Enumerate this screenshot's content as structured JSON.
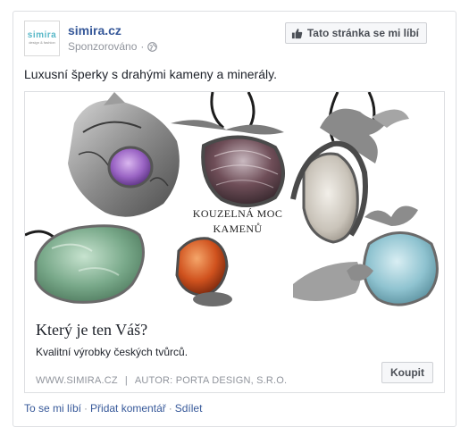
{
  "post": {
    "page_name": "simira.cz",
    "logo": {
      "wordmark": "simira",
      "sub": "design & fashion"
    },
    "sponsored_label": "Sponzorováno",
    "sponsored_separator": "·",
    "like_page_label": "Tato stránka se mi líbí",
    "text": "Luxusní šperky s drahými kameny a minerály."
  },
  "attachment": {
    "image_tagline_line1": "KOUZELNÁ MOC",
    "image_tagline_line2": "KAMENŮ",
    "title": "Který je ten Váš?",
    "description": "Kvalitní výrobky českých tvůrců.",
    "caption_domain": "WWW.SIMIRA.CZ",
    "caption_separator": "|",
    "caption_author": "AUTOR: PORTA DESIGN, S.R.O.",
    "cta_label": "Koupit"
  },
  "actions": {
    "like": "To se mi líbí",
    "comment": "Přidat komentář",
    "share": "Sdílet",
    "separator": "·"
  },
  "colors": {
    "link_blue": "#365899",
    "meta_gray": "#90949c",
    "border": "#dddfe2",
    "logo_teal": "#58b8c8"
  },
  "icons": [
    "globe-icon",
    "thumbs-up-icon"
  ]
}
